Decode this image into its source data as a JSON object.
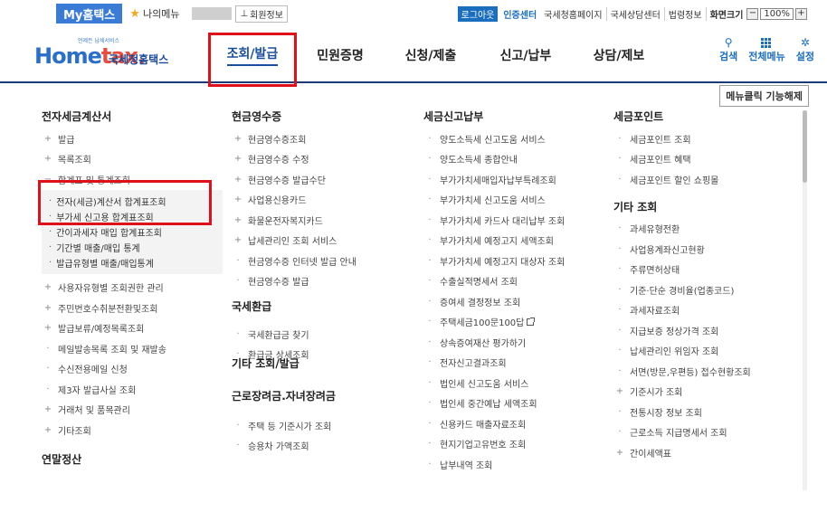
{
  "topbar": {
    "my_hometax": "My홈택스",
    "my_menu": "나의메뉴",
    "member_info": "회원정보",
    "logout": "로그아웃",
    "cert_center": "인증센터",
    "links": [
      "국세청홈페이지",
      "국세상담센터",
      "법령정보"
    ],
    "screen_size": "화면크기",
    "zoom_minus": "−",
    "zoom_value": "100%",
    "zoom_plus": "+"
  },
  "logo": {
    "tag": "언제든 납세서비스",
    "word_home": "Home",
    "word_tax": "tax.",
    "korean": "국세청홈택스"
  },
  "gnb": [
    "조회/발급",
    "민원증명",
    "신청/제출",
    "신고/납부",
    "상담/제보"
  ],
  "util": {
    "search": "검색",
    "all_menu": "전체메뉴",
    "settings": "설정"
  },
  "unfix_button": "메뉴클릭 기능해제",
  "col1": {
    "title": "전자세금계산서",
    "items_before": [
      {
        "mark": "+",
        "label": "발급"
      },
      {
        "mark": "+",
        "label": "목록조회"
      },
      {
        "mark": "−",
        "label": "합계표 및 통계조회"
      }
    ],
    "submenu": [
      "전자(세금)계산서 합계표조회",
      "부가세 신고용 합계표조회",
      "간이과세자 매입 합계표조회",
      "기간별 매출/매입 통계",
      "발급유형별 매출/매입통계"
    ],
    "items_after": [
      {
        "mark": "+",
        "label": "사용자유형별 조회권한 관리"
      },
      {
        "mark": "+",
        "label": "주민번호수취분전환및조회"
      },
      {
        "mark": "+",
        "label": "발급보류/예정목록조회"
      },
      {
        "mark": "·",
        "label": "메일발송목록 조회 및 재발송"
      },
      {
        "mark": "·",
        "label": "수신전용메일 신청"
      },
      {
        "mark": "·",
        "label": "제3자 발급사실 조회"
      },
      {
        "mark": "+",
        "label": "거래처 및 품목관리"
      },
      {
        "mark": "+",
        "label": "기타조회"
      }
    ],
    "title2": "연말정산"
  },
  "col2": {
    "title": "현금영수증",
    "items": [
      {
        "mark": "+",
        "label": "현금영수증조회"
      },
      {
        "mark": "+",
        "label": "현금영수증 수정"
      },
      {
        "mark": "+",
        "label": "현금영수증 발급수단"
      },
      {
        "mark": "+",
        "label": "사업용신용카드"
      },
      {
        "mark": "+",
        "label": "화물운전자복지카드"
      },
      {
        "mark": "+",
        "label": "납세관리인 조회 서비스"
      },
      {
        "mark": "·",
        "label": "현금영수증 인터넷 발급 안내"
      },
      {
        "mark": "·",
        "label": "현금영수증 발급"
      }
    ],
    "title2": "국세환급",
    "items2": [
      {
        "mark": "·",
        "label": "국세환급금 찾기"
      },
      {
        "mark": "·",
        "label": "환급금 상세조회"
      }
    ],
    "title3": "기타 조회/발급",
    "title4": "근로장려금.자녀장려금",
    "items4": [
      {
        "mark": "·",
        "label": "주택 등 기준시가 조회"
      },
      {
        "mark": "·",
        "label": "승용차 가액조회"
      }
    ]
  },
  "col3": {
    "title": "세금신고납부",
    "items": [
      "양도소득세 신고도움 서비스",
      "양도소득세 종합안내",
      "부가가치세매입자납부특례조회",
      "부가가치세 신고도움 서비스",
      "부가가치세 카드사 대리납부 조회",
      "부가가치세 예정고지 세액조회",
      "부가가치세 예정고지 대상자 조회",
      "수출실적명세서 조회",
      "증여세 결정정보 조회",
      "주택세금100문100답",
      "상속증여재산 평가하기",
      "전자신고결과조회",
      "법인세 신고도움 서비스",
      "법인세 중간예납 세액조회",
      "신용카드 매출자료조회",
      "현지기업고유번호 조회",
      "납부내역 조회"
    ]
  },
  "col4": {
    "title": "세금포인트",
    "items": [
      "세금포인트 조회",
      "세금포인트 혜택",
      "세금포인트 할인 쇼핑몰"
    ],
    "title2": "기타 조회",
    "items2": [
      {
        "mark": "·",
        "label": "과세유형전환"
      },
      {
        "mark": "·",
        "label": "사업용계좌신고현황"
      },
      {
        "mark": "·",
        "label": "주류면허상태"
      },
      {
        "mark": "·",
        "label": "기준·단순 경비율(업종코드)"
      },
      {
        "mark": "·",
        "label": "과세자료조회"
      },
      {
        "mark": "·",
        "label": "지급보증 정상가격 조회"
      },
      {
        "mark": "·",
        "label": "납세관리인 위임자 조회"
      },
      {
        "mark": "·",
        "label": "서면(방문,우편등) 접수현황조회"
      },
      {
        "mark": "+",
        "label": "기준시가 조회"
      },
      {
        "mark": "·",
        "label": "전통시장 정보 조회"
      },
      {
        "mark": "·",
        "label": "근로소득 지급명세서 조회"
      },
      {
        "mark": "+",
        "label": "간이세액표"
      }
    ]
  }
}
